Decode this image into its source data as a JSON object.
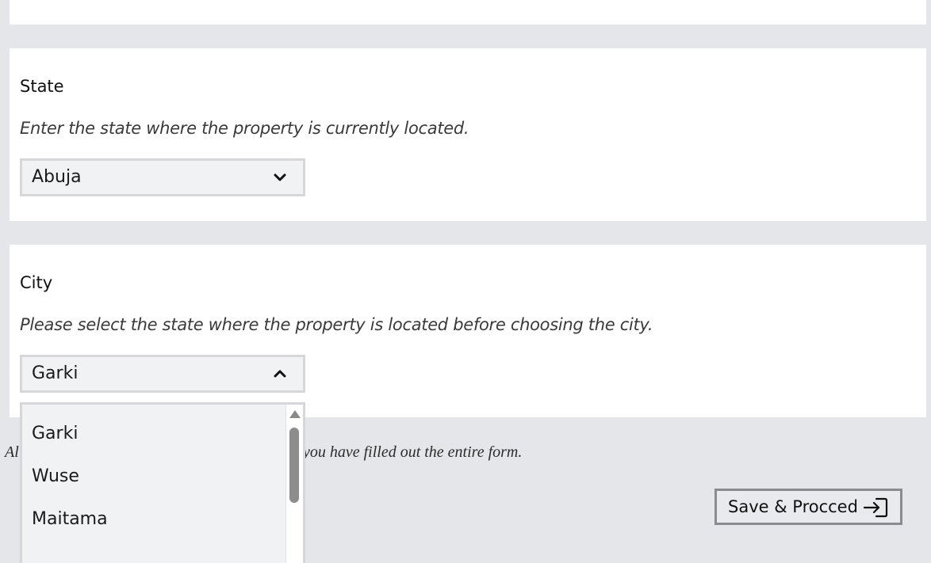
{
  "state_section": {
    "label": "State",
    "help": "Enter the state where the property is currently located.",
    "selected": "Abuja",
    "icon": "chevron-down-icon"
  },
  "city_section": {
    "label": "City",
    "help": "Please select the state where the property is located before choosing the city.",
    "selected": "Garki",
    "icon": "chevron-up-icon",
    "options": [
      "Garki",
      "Wuse",
      "Maitama"
    ]
  },
  "footer": {
    "notice": "Al                                    'Next Section\" button will appear only after you have filled out the entire form.",
    "save_label": "Save & Procced",
    "save_icon": "sign-in-arrow-icon"
  }
}
